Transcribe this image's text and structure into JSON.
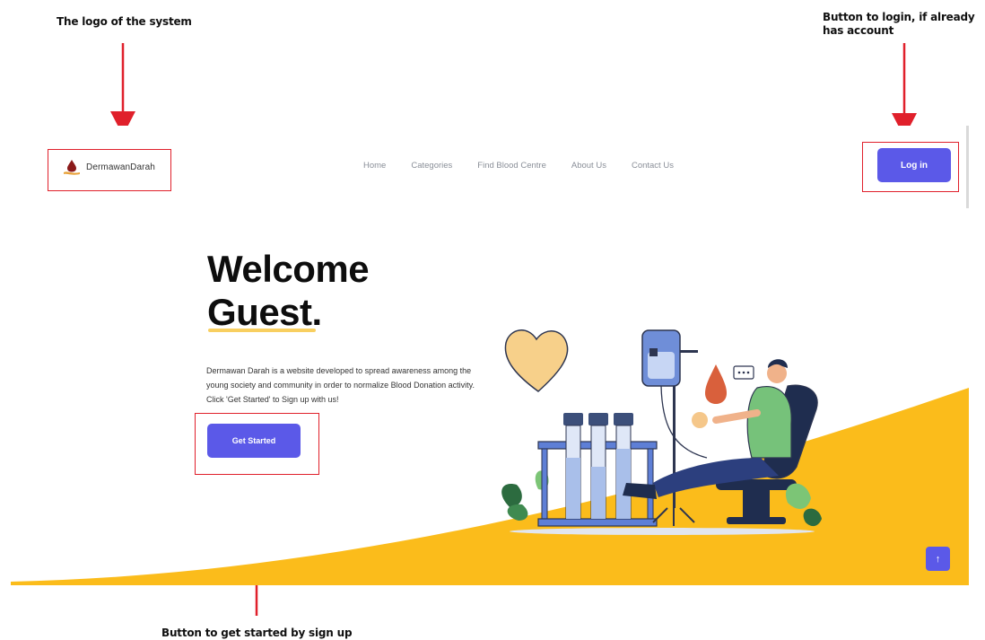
{
  "annotations": {
    "logo_note": "The logo of the system",
    "login_note": "Button to login, if already has account",
    "start_note": "Button to get started by sign up"
  },
  "header": {
    "logo_text": "DermawanDarah",
    "logo_icon": "blood-drop-hand-icon",
    "nav": [
      "Home",
      "Categories",
      "Find Blood Centre",
      "About Us",
      "Contact Us"
    ],
    "login_label": "Log in"
  },
  "hero": {
    "title_line1": "Welcome",
    "title_line2": "Guest.",
    "description": "Dermawan Darah is a website developed to spread awareness among the young society and community in order to normalize Blood Donation activity. Click 'Get Started' to Sign up with us!",
    "cta_label": "Get Started"
  },
  "scroll_top_icon": "arrow-up-icon",
  "colors": {
    "primary": "#5b59e8",
    "accent_yellow": "#fbbc1b",
    "annotation_red": "#e0202b"
  }
}
